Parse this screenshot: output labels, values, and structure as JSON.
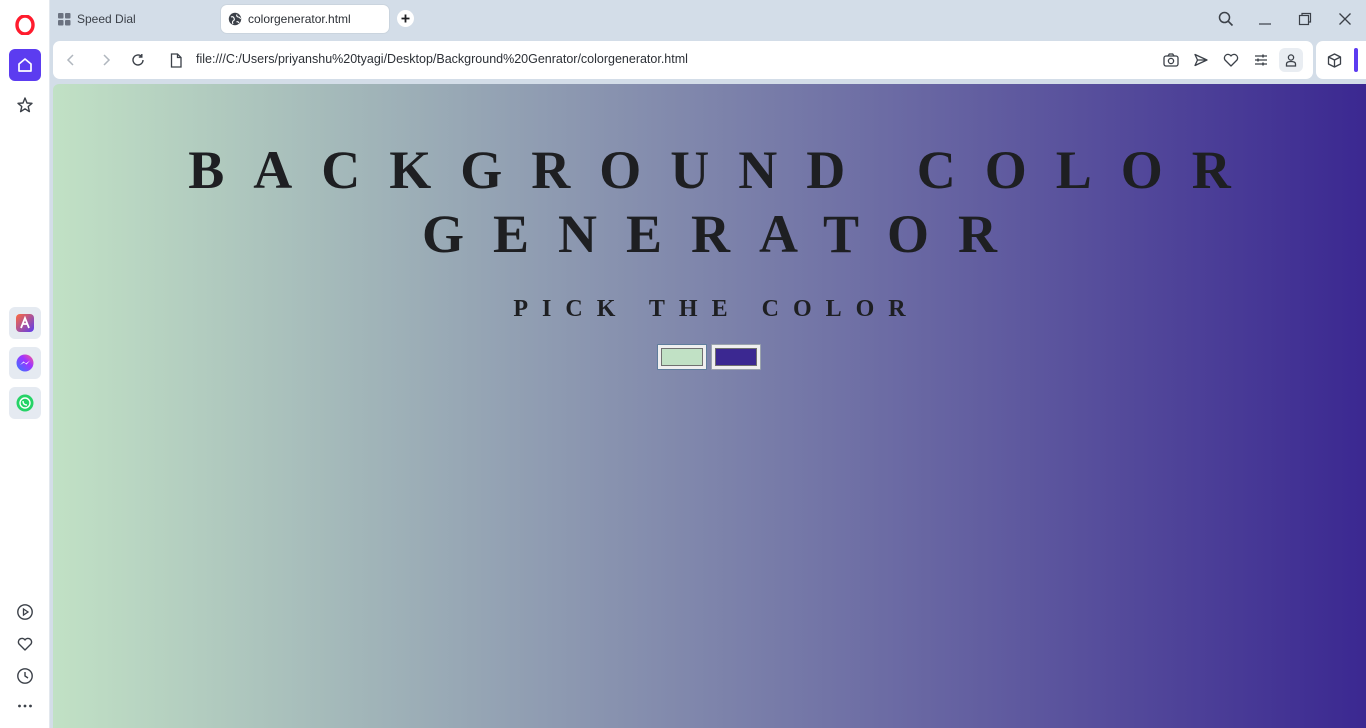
{
  "browser": {
    "tabs": [
      {
        "label": "Speed Dial",
        "active": false
      },
      {
        "label": "colorgenerator.html",
        "active": true
      }
    ],
    "url": "file:///C:/Users/priyanshu%20tyagi/Desktop/Background%20Genrator/colorgenerator.html",
    "accent_color": "#5c3cf0"
  },
  "sidebar": {
    "top_items": [
      "opera-logo-icon",
      "home-icon",
      "star-icon"
    ],
    "apps": [
      "aria-icon",
      "messenger-icon",
      "whatsapp-icon"
    ],
    "bottom_items": [
      "player-icon",
      "heart-icon",
      "history-icon",
      "more-icon"
    ]
  },
  "page": {
    "title": "BACKGROUND COLOR GENERATOR",
    "subtitle": "PICK THE COLOR",
    "gradient": {
      "direction": "to right",
      "color1": "#c1e1c5",
      "color2": "#3b2891"
    },
    "color_inputs": [
      {
        "value": "#c1e1c5"
      },
      {
        "value": "#3b2891"
      }
    ]
  }
}
